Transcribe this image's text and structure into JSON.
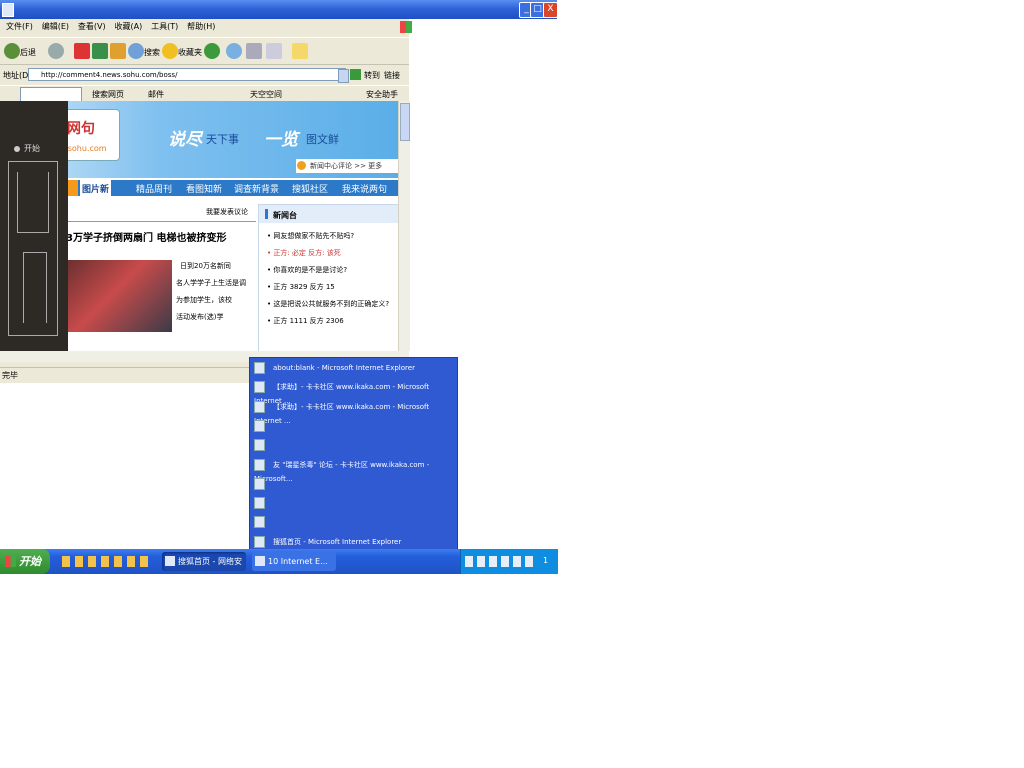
{
  "window": {
    "min_label": "_",
    "max_label": "□",
    "close_label": "X"
  },
  "menu": [
    "文件(F)",
    "编辑(E)",
    "查看(V)",
    "收藏(A)",
    "工具(T)",
    "帮助(H)"
  ],
  "toolbar": {
    "back_label": "后退",
    "search_label": "搜索",
    "favorites_label": "收藏夹"
  },
  "address": {
    "label": "地址(D)",
    "url": "http://comment4.news.sohu.com/boss/",
    "go_label": "转到",
    "links_label": "链接"
  },
  "links_toolbar": {
    "search_web": "搜索网页",
    "mail": "邮件",
    "tooltip": "天空空间",
    "safety": "安全助手"
  },
  "page": {
    "banner_slogan_1": "说尽",
    "banner_slogan_2": "天下事",
    "banner_slogan_3": "一览",
    "banner_slogan_4": "图文鲜",
    "logo_text": "网句",
    "logo_url": "s.sohu.com",
    "overlay_start": "开始",
    "nav_items": [
      "图片新",
      "精品周刊",
      "看图知新",
      "调查新背景",
      "搜狐社区",
      "我来说两句"
    ],
    "small_link": "我要发表议论",
    "headline": "3万学子挤倒两扇门 电梯也被挤变形",
    "article_lines": [
      "日到20万名新同",
      "名人学学子上生活是调",
      "为参加学生，该校",
      "活动发布(选)学"
    ],
    "rightbox_title": "新闻台",
    "rightbox_items": [
      "• 网友想做家不贴先不贴吗?",
      "• 正方: 必定 反方: 该死",
      "• 你喜欢的是不是是讨论?",
      "• 正方 3829 反方 15",
      "• 这是把说公共就服务不到的正确定义?",
      "• 正方 1111 反方 2306"
    ],
    "banner_hint": "新闻中心评论 >> 更多"
  },
  "status": {
    "text": "完毕"
  },
  "popup_items": [
    {
      "label": "about:blank - Microsoft Internet Explorer"
    },
    {
      "label": "【求助】- 卡卡社区 www.ikaka.com - Microsoft Internet ..."
    },
    {
      "label": "【求助】- 卡卡社区 www.ikaka.com - Microsoft Internet ..."
    },
    {
      "label": ""
    },
    {
      "label": ""
    },
    {
      "label": "友 \"瑞星杀毒\" 论坛 - 卡卡社区 www.ikaka.com - Microsoft..."
    },
    {
      "label": ""
    },
    {
      "label": ""
    },
    {
      "label": ""
    },
    {
      "label": "搜狐首页 - Microsoft Internet Explorer"
    }
  ],
  "taskbar": {
    "start_label": "开始",
    "task1": "搜狐首页 - 网络安全...",
    "task2": "10 Internet E...",
    "clock": "1"
  }
}
